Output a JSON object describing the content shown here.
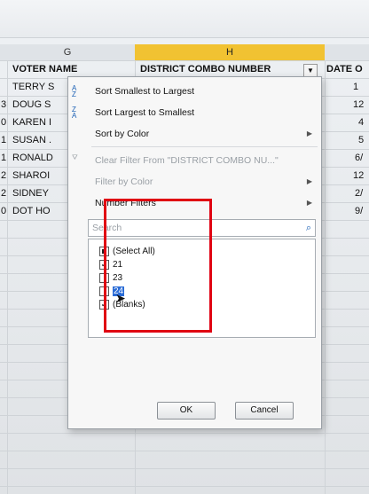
{
  "columns": {
    "g": "G",
    "h": "H"
  },
  "headers": {
    "voter_name": "VOTER NAME",
    "district_combo": "DISTRICT COMBO NUMBER",
    "date": "DATE O"
  },
  "rows": [
    {
      "left": "",
      "name": "TERRY S",
      "date": "1"
    },
    {
      "left": "3",
      "name": "DOUG S",
      "date": "12"
    },
    {
      "left": "0",
      "name": "KAREN I",
      "date": "4"
    },
    {
      "left": "1",
      "name": "SUSAN .",
      "date": "5"
    },
    {
      "left": "1",
      "name": "RONALD",
      "date": "6/"
    },
    {
      "left": "2",
      "name": "SHAROI",
      "date": "12"
    },
    {
      "left": "2",
      "name": "SIDNEY",
      "date": "2/"
    },
    {
      "left": "0",
      "name": "DOT HO",
      "date": "9/"
    }
  ],
  "menu": {
    "sort_asc": "Sort Smallest to Largest",
    "sort_desc": "Sort Largest to Smallest",
    "sort_color": "Sort by Color",
    "clear_filter": "Clear Filter From \"DISTRICT COMBO NU...\"",
    "filter_color": "Filter by Color",
    "number_filters": "Number Filters",
    "search_placeholder": "Search",
    "items": [
      "(Select All)",
      "21",
      "23",
      "24",
      "(Blanks)"
    ],
    "ok": "OK",
    "cancel": "Cancel"
  },
  "colors": {
    "accent_header": "#f1c232",
    "highlight": "#2b6cd6",
    "annotation": "#e00012"
  },
  "checked": {
    "select_all": "indeterminate",
    "21": true,
    "23": false,
    "24": false,
    "blanks": true
  }
}
